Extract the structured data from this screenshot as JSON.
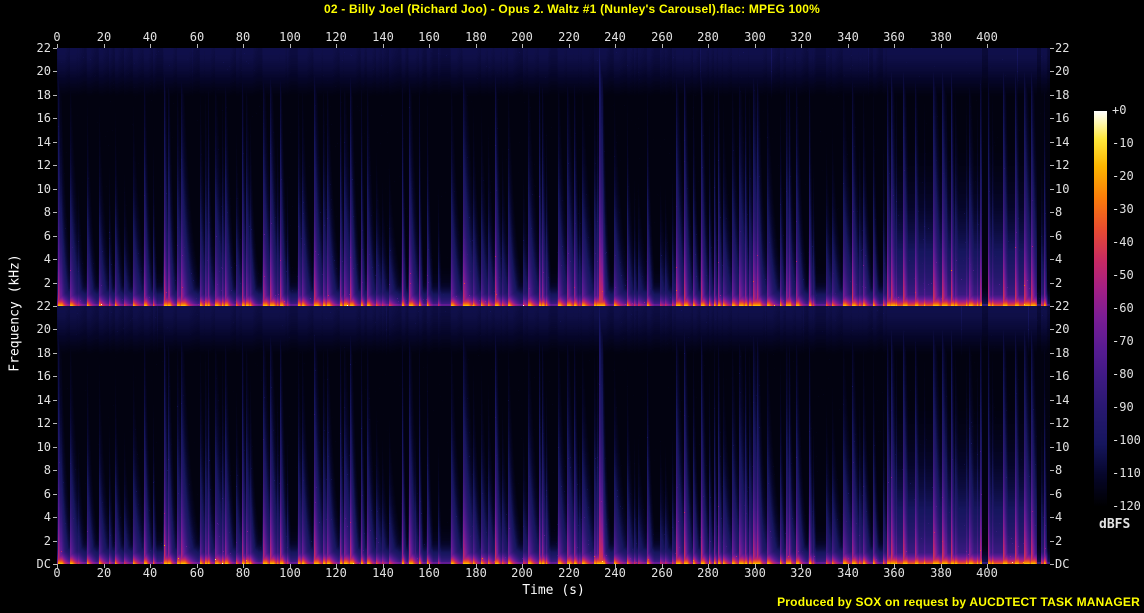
{
  "title": "02 - Billy Joel (Richard Joo) - Opus 2. Waltz #1 (Nunley's Carousel).flac: MPEG 100%",
  "footer": {
    "text": "Produced by SOX on request by AUCDTECT TASK MANAGER"
  },
  "colors": {
    "background": "#000000",
    "title_text": "#ffff00",
    "footer_text": "#ffff00",
    "axis_text": "#e2e2e2",
    "axis_tick": "#b8b8b8",
    "ylabel_text": "#ffffff"
  },
  "chart_data": {
    "type": "heatmap",
    "subtype": "audio-spectrogram",
    "title": "02 - Billy Joel (Richard Joo) - Opus 2. Waltz #1 (Nunley's Carousel).flac: MPEG 100%",
    "channels": 2,
    "channel_names": [
      "channel-1",
      "channel-2"
    ],
    "xlabel": "Time (s)",
    "ylabel": "Frequency (kHz)",
    "x_ticks": [
      0,
      20,
      40,
      60,
      80,
      100,
      120,
      140,
      160,
      180,
      200,
      220,
      240,
      260,
      280,
      300,
      320,
      340,
      360,
      380,
      400
    ],
    "x_range_s": [
      0,
      427
    ],
    "freq_ticks": [
      "22",
      "20",
      "18",
      "16",
      "14",
      "12",
      "10",
      "8",
      "6",
      "4",
      "2",
      "DC"
    ],
    "freq_range_khz": [
      0,
      22
    ],
    "grid": false,
    "colorbar": {
      "unit": "dBFS",
      "position": "right",
      "ticks": [
        "+0",
        "-10",
        "-20",
        "-30",
        "-40",
        "-50",
        "-60",
        "-70",
        "-80",
        "-90",
        "-100",
        "-110",
        "-120"
      ],
      "range_db": [
        0,
        -120
      ]
    },
    "palette": [
      {
        "pos": 0.0,
        "color": "#000000"
      },
      {
        "pos": 0.08,
        "color": "#06062a"
      },
      {
        "pos": 0.16,
        "color": "#16165e"
      },
      {
        "pos": 0.24,
        "color": "#26186e"
      },
      {
        "pos": 0.32,
        "color": "#3c1a82"
      },
      {
        "pos": 0.4,
        "color": "#581b92"
      },
      {
        "pos": 0.48,
        "color": "#7c1d95"
      },
      {
        "pos": 0.55,
        "color": "#a31f85"
      },
      {
        "pos": 0.62,
        "color": "#c62964"
      },
      {
        "pos": 0.7,
        "color": "#e84b31"
      },
      {
        "pos": 0.78,
        "color": "#fa7c0a"
      },
      {
        "pos": 0.86,
        "color": "#fcb500"
      },
      {
        "pos": 0.93,
        "color": "#ffe83c"
      },
      {
        "pos": 0.97,
        "color": "#fff8b0"
      },
      {
        "pos": 1.0,
        "color": "#ffffff"
      }
    ],
    "features": {
      "render_seed": 11,
      "note_onset_spacing_s": [
        1.3,
        5.5
      ],
      "tall_spike_s": 233,
      "loud_section_s": [
        357.5,
        421.5
      ],
      "silence_gaps_s": [
        [
          397.5,
          400.3
        ],
        [
          421.5,
          423.0
        ]
      ],
      "coda_s": [
        423.0,
        425.3
      ],
      "fade_start_s": 425.3,
      "noise_shelf_top_khz": [
        17,
        22
      ]
    }
  }
}
